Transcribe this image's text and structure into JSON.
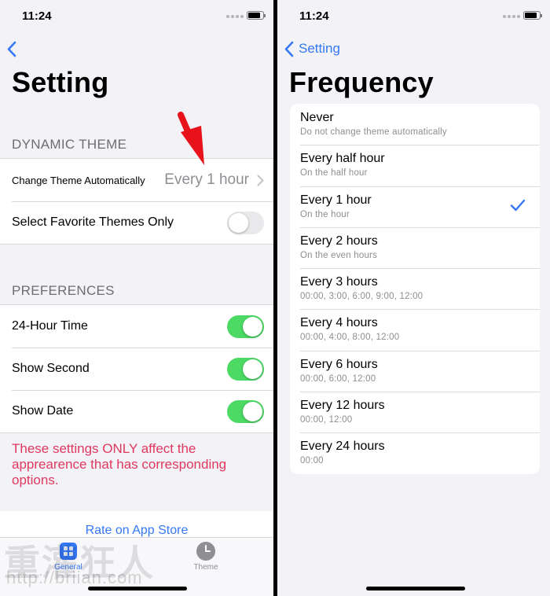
{
  "status_time": "11:24",
  "left": {
    "title": "Setting",
    "sections": [
      {
        "header": "DYNAMIC THEME",
        "rows": [
          {
            "label": "Change Theme Automatically",
            "value": "Every 1 hour"
          },
          {
            "label": "Select Favorite Themes Only",
            "toggle": false
          }
        ]
      },
      {
        "header": "PREFERENCES",
        "rows": [
          {
            "label": "24-Hour Time",
            "toggle": true
          },
          {
            "label": "Show Second",
            "toggle": true
          },
          {
            "label": "Show Date",
            "toggle": true
          }
        ]
      }
    ],
    "footer_note": "These settings ONLY affect the apprearence that has corresponding options.",
    "rate_link": "Rate on App Store",
    "tabs": [
      {
        "label": "General",
        "icon": "grid-icon",
        "selected": true
      },
      {
        "label": "Theme",
        "icon": "clock-icon",
        "selected": false
      }
    ],
    "watermark": "重灌狂人",
    "watermark_url": "http://briian.com"
  },
  "right": {
    "back_label": "Setting",
    "title": "Frequency",
    "options": [
      {
        "label": "Never",
        "sub": "Do not change theme automatically",
        "selected": false
      },
      {
        "label": "Every half hour",
        "sub": "On the half hour",
        "selected": false
      },
      {
        "label": "Every 1 hour",
        "sub": "On the hour",
        "selected": true
      },
      {
        "label": "Every 2 hours",
        "sub": "On the even hours",
        "selected": false
      },
      {
        "label": "Every 3 hours",
        "sub": "00:00, 3:00, 6:00, 9:00, 12:00",
        "selected": false
      },
      {
        "label": "Every 4 hours",
        "sub": "00:00, 4:00, 8:00, 12:00",
        "selected": false
      },
      {
        "label": "Every 6 hours",
        "sub": "00:00, 6:00, 12:00",
        "selected": false
      },
      {
        "label": "Every 12 hours",
        "sub": "00:00, 12:00",
        "selected": false
      },
      {
        "label": "Every 24 hours",
        "sub": "00:00",
        "selected": false
      }
    ]
  },
  "colors": {
    "accent": "#3478f6",
    "toggle_on": "#4cd964",
    "note_red": "#e0385e",
    "arrow_red": "#e8121a"
  }
}
